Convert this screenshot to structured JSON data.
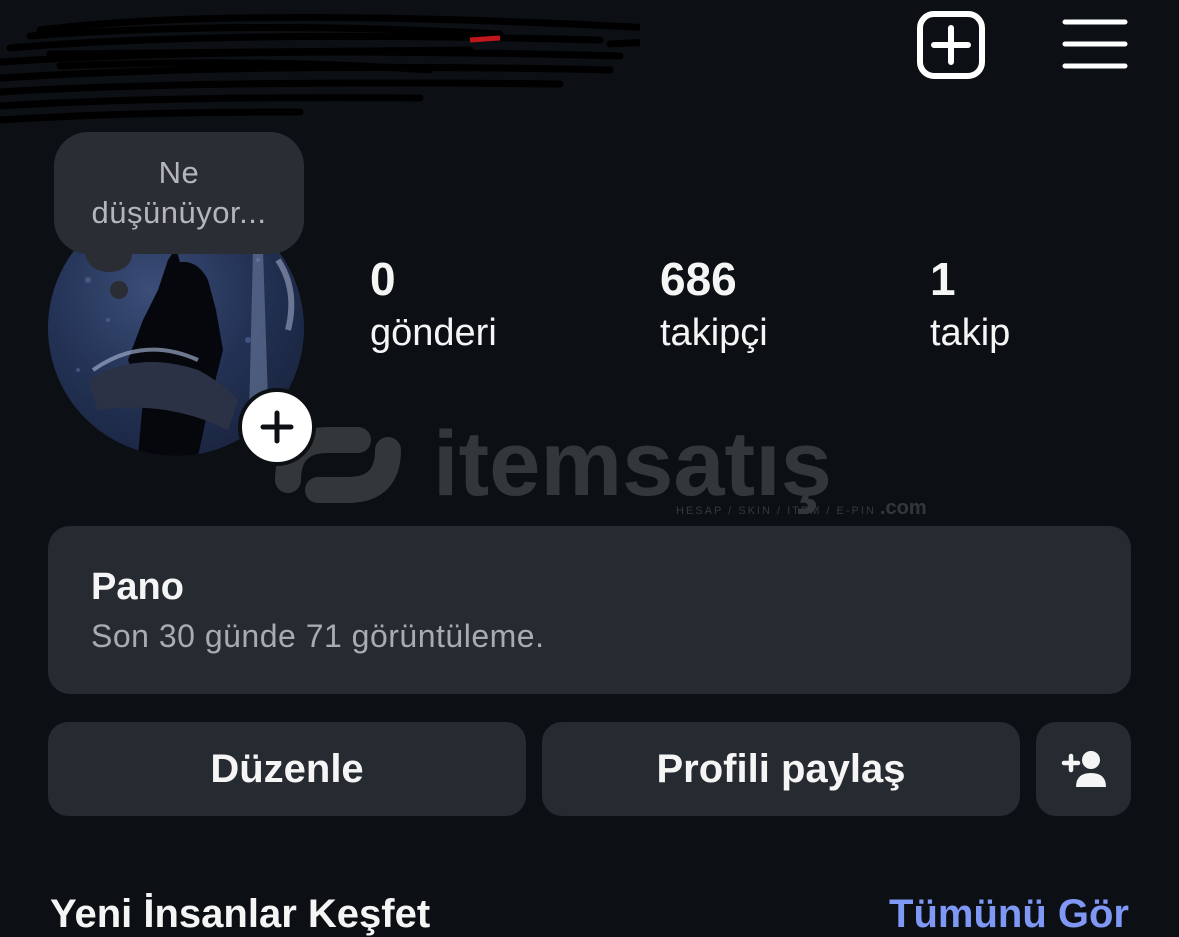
{
  "header": {
    "username": "",
    "new_post_icon": "plus-square-icon",
    "menu_icon": "hamburger-menu-icon"
  },
  "note": {
    "text": "Ne düşünüyor..."
  },
  "profile": {
    "stats": [
      {
        "value": "0",
        "label": "gönderi"
      },
      {
        "value": "686",
        "label": "takipçi"
      },
      {
        "value": "1",
        "label": "takip"
      }
    ]
  },
  "watermark": {
    "text": "itemsatış",
    "sub": "HESAP / SKIN / ITEM / E-PIN",
    "domain": ".com"
  },
  "dashboard": {
    "title": "Pano",
    "subtitle": "Son 30 günde 71 görüntüleme."
  },
  "actions": {
    "edit": "Düzenle",
    "share": "Profili paylaş",
    "add_user_icon": "add-person-icon"
  },
  "discover": {
    "title": "Yeni İnsanlar Keşfet",
    "see_all": "Tümünü Gör"
  },
  "colors": {
    "background": "#0c1014",
    "card": "#262a31",
    "accent": "#7f97f5"
  }
}
